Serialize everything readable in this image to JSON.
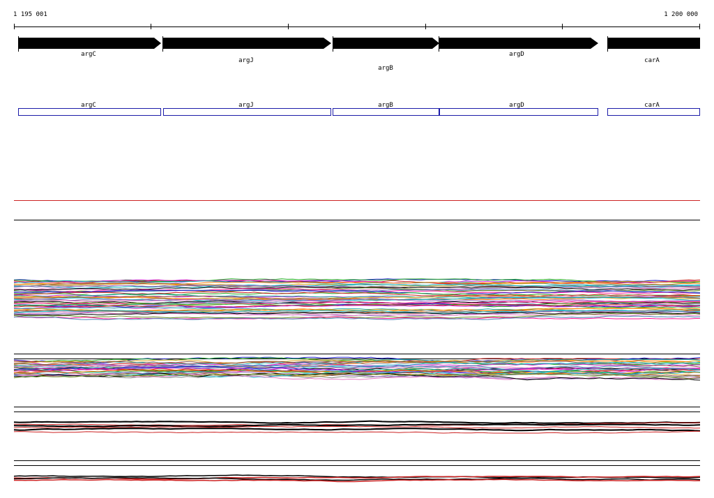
{
  "ruler": {
    "start_label": "1 195 001",
    "end_label": "1 200 000"
  },
  "genes": [
    {
      "name": "argC",
      "strand": "+"
    },
    {
      "name": "argJ",
      "strand": "+"
    },
    {
      "name": "argB",
      "strand": "+"
    },
    {
      "name": "argD",
      "strand": "+"
    },
    {
      "name": "carA",
      "strand": "+"
    }
  ],
  "annotation_boxes": [
    {
      "label": "argC"
    },
    {
      "label": "argJ"
    },
    {
      "label": "argB"
    },
    {
      "label": "argD"
    },
    {
      "label": "carA"
    }
  ],
  "colors": {
    "gene_arrow": "#000000",
    "annotation_box": "#1a1aa8",
    "separator_red": "#cc2222",
    "separator_black": "#000000"
  },
  "track_palette": [
    "#1f1fcc",
    "#22aa22",
    "#cc2222",
    "#cc22cc",
    "#22aaaa",
    "#d4a017",
    "#ff7f0e",
    "#8c564b",
    "#7f7f7f",
    "#17becf",
    "#9467bd",
    "#e377c2",
    "#000000",
    "#6b8e23",
    "#ff1493",
    "#4682b4"
  ]
}
